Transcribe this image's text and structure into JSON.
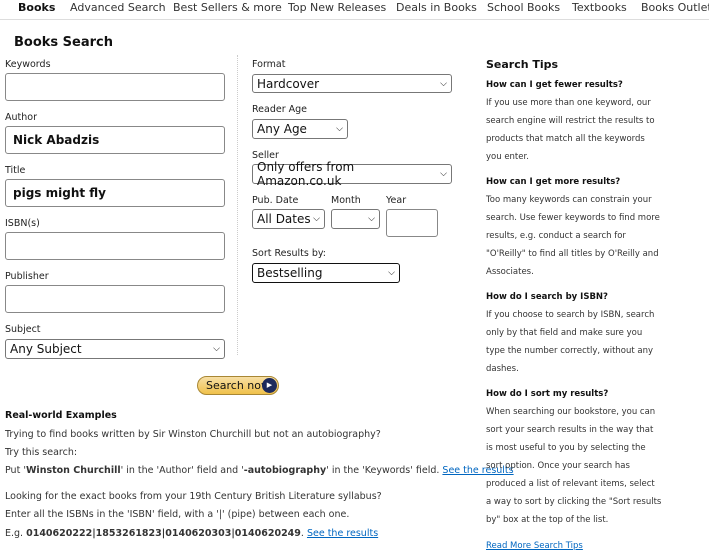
{
  "nav": [
    "Books",
    "Advanced Search",
    "Best Sellers & more",
    "Top New Releases",
    "Deals in Books",
    "School Books",
    "Textbooks",
    "Books Outlet"
  ],
  "page_title": "Books Search",
  "form": {
    "keywords": {
      "label": "Keywords",
      "value": ""
    },
    "author": {
      "label": "Author",
      "value": "Nick Abadzis"
    },
    "title": {
      "label": "Title",
      "value": "pigs might fly"
    },
    "isbn": {
      "label": "ISBN(s)",
      "value": ""
    },
    "publisher": {
      "label": "Publisher",
      "value": ""
    },
    "subject": {
      "label": "Subject",
      "value": "Any Subject"
    },
    "format": {
      "label": "Format",
      "value": "Hardcover"
    },
    "reader_age": {
      "label": "Reader Age",
      "value": "Any Age"
    },
    "seller": {
      "label": "Seller",
      "value": "Only offers from Amazon.co.uk"
    },
    "pub_date": {
      "label": "Pub. Date",
      "value": "All Dates"
    },
    "month": {
      "label": "Month",
      "value": ""
    },
    "year": {
      "label": "Year",
      "value": ""
    },
    "sort": {
      "label": "Sort Results by:",
      "value": "Bestselling"
    },
    "search_button": "Search now"
  },
  "examples": {
    "heading": "Real-world Examples",
    "q1": "Trying to find books written by Sir Winston Churchill but not an autobiography?",
    "try": "Try this search:",
    "put": "Put '",
    "wc": "Winston Churchill",
    "mid": "' in the 'Author' field and '",
    "auto": "-autobiography",
    "end": "' in the 'Keywords' field. ",
    "see1": "See the results",
    "q2": "Looking for the exact books from your 19th Century British Literature syllabus?",
    "enter": "Enter all the ISBNs in the 'ISBN' field, with a '|' (pipe) between each one.",
    "eg": "E.g. ",
    "isbns": "0140620222|1853261823|0140620303|0140620249",
    "dot": ". ",
    "see2": "See the results"
  },
  "tips": {
    "heading": "Search Tips",
    "items": [
      {
        "q": "How can I get fewer results?",
        "lines": [
          "If you use more than one keyword, our",
          "search engine will restrict the results to",
          "products that match all the keywords",
          "you enter."
        ]
      },
      {
        "q": "How can I get more results?",
        "lines": [
          "Too many keywords can constrain your",
          "search. Use fewer keywords to find more",
          "results, e.g. conduct a search for",
          "\"O'Reilly\" to find all titles by O'Reilly and",
          "Associates."
        ]
      },
      {
        "q": "How do I search by ISBN?",
        "lines": [
          "If you choose to search by ISBN, search",
          "only by that field and make sure you",
          "type the number correctly, without any",
          "dashes."
        ]
      },
      {
        "q": "How do I sort my results?",
        "lines": [
          "When searching our bookstore, you can",
          "sort your search results in the way that",
          "is most useful to you by selecting the",
          "sort option. Once your search has",
          "produced a list of relevant items, select",
          "a way to sort by clicking the \"Sort results",
          "by\" box at the top of the list."
        ]
      }
    ],
    "more_link": "Read More Search Tips"
  }
}
